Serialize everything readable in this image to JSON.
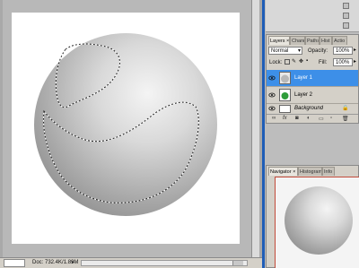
{
  "status_bar": {
    "zoom": "",
    "doc_info": "Doc: 732.4K/1.89M"
  },
  "layers_panel": {
    "tabs": [
      "Layers",
      "Chann",
      "Paths",
      "Hist",
      "Actio"
    ],
    "blend_mode": "Normal",
    "opacity_label": "Opacity:",
    "opacity_value": "100%",
    "lock_label": "Lock:",
    "fill_label": "Fill:",
    "fill_value": "100%",
    "layers": [
      {
        "name": "Layer 1",
        "selected": true
      },
      {
        "name": "Layer 2",
        "selected": false
      },
      {
        "name": "Background",
        "selected": false
      }
    ],
    "bottom_icons": [
      "link-icon",
      "fx-icon",
      "mask-icon",
      "adjustment-icon",
      "folder-icon",
      "new-layer-icon",
      "trash-icon"
    ]
  },
  "navigator_panel": {
    "tabs": [
      "Navigator",
      "Histogram",
      "Info"
    ]
  },
  "colors": {
    "selection_highlight": "#3d8fe8",
    "dock_bar": "#1f5db7",
    "navigator_frame": "#c24b3a"
  }
}
